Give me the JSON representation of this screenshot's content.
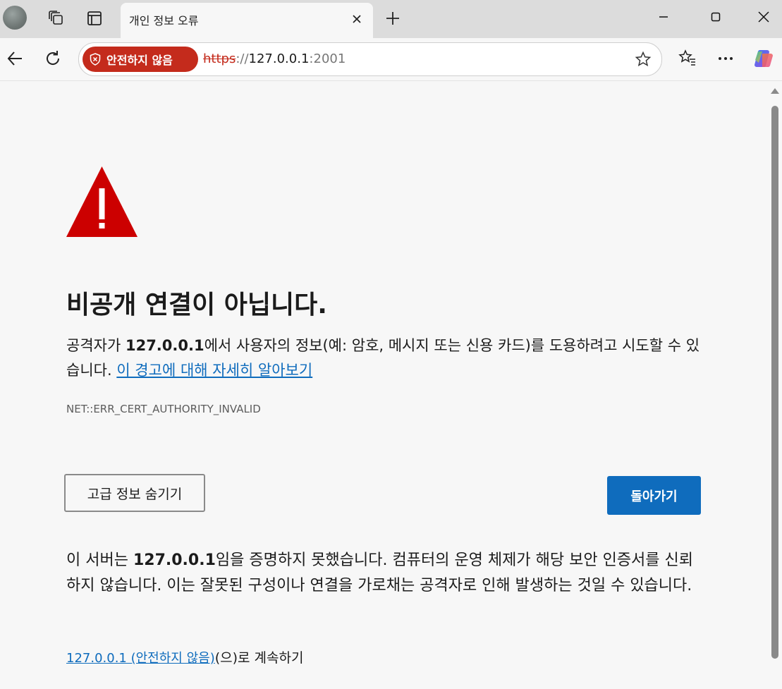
{
  "browser": {
    "tab_title": "개인 정보 오류",
    "security_badge": "안전하지 않음",
    "url": {
      "scheme": "https",
      "separator": "://",
      "host": "127.0.0.1",
      "port": ":2001"
    }
  },
  "page": {
    "heading": "비공개 연결이 아닙니다.",
    "desc_prefix": "공격자가 ",
    "desc_host": "127.0.0.1",
    "desc_suffix": "에서 사용자의 정보(예: 암호, 메시지 또는 신용 카드)를 도용하려고 시도할 수 있습니다. ",
    "learn_more_link": "이 경고에 대해 자세히 알아보기",
    "error_code": "NET::ERR_CERT_AUTHORITY_INVALID",
    "advanced_button": "고급 정보 숨기기",
    "back_button": "돌아가기",
    "details_prefix": "이 서버는 ",
    "details_host": "127.0.0.1",
    "details_suffix": "임을 증명하지 못했습니다. 컴퓨터의 운영 체제가 해당 보안 인증서를 신뢰하지 않습니다. 이는 잘못된 구성이나 연결을 가로채는 공격자로 인해 발생하는 것일 수 있습니다.",
    "proceed_link": "127.0.0.1 (안전하지 않음)",
    "proceed_suffix": "(으)로 계속하기"
  },
  "colors": {
    "accent": "#0f6cbd",
    "danger": "#c42b1c",
    "warning_triangle": "#cc0000"
  }
}
